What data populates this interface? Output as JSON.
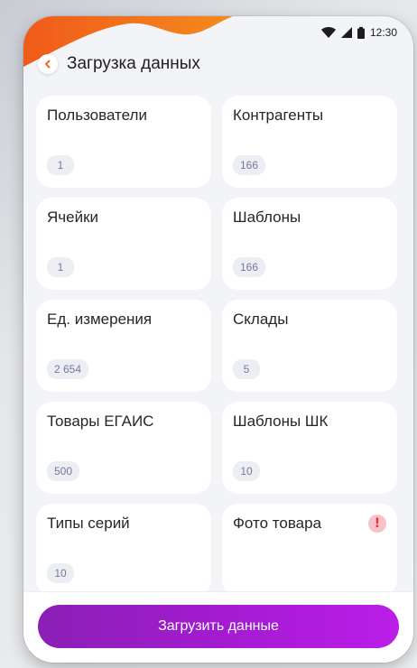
{
  "status_bar": {
    "time": "12:30",
    "icons": [
      "wifi-icon",
      "signal-icon",
      "battery-icon"
    ]
  },
  "header": {
    "title": "Загрузка данных",
    "back_icon": "chevron-left-icon",
    "accent_color": "#f26a1b"
  },
  "cards": [
    {
      "label": "Пользователи",
      "count": "1"
    },
    {
      "label": "Контрагенты",
      "count": "166"
    },
    {
      "label": "Ячейки",
      "count": "1"
    },
    {
      "label": "Шаблоны",
      "count": "166"
    },
    {
      "label": "Ед. измерения",
      "count": "2 654"
    },
    {
      "label": "Склады",
      "count": "5"
    },
    {
      "label": "Товары ЕГАИС",
      "count": "500"
    },
    {
      "label": "Шаблоны ШК",
      "count": "10"
    },
    {
      "label": "Типы серий",
      "count": "10"
    },
    {
      "label": "Фото товара",
      "warning_icon": "!",
      "warning_color": "#e5343f"
    }
  ],
  "footer": {
    "button_label": "Загрузить данные",
    "button_gradient": [
      "#8b1fb4",
      "#bb1ee8"
    ]
  }
}
